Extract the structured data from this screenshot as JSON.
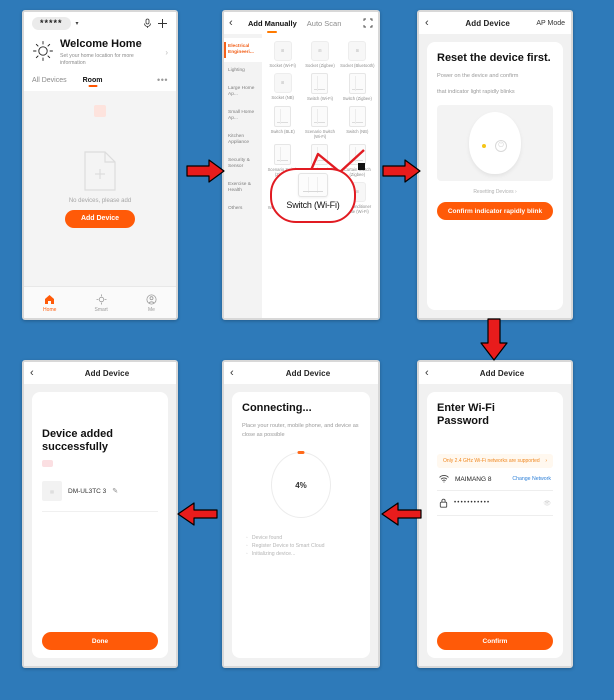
{
  "flow": {
    "background_color": "#2e7ab9",
    "accent_color": "#ff5a08",
    "arrow_color": "#e81c1c",
    "highlight_color": "#e11b22"
  },
  "screen1": {
    "home_name": "*****",
    "caret_icon": "chevron-down-icon",
    "mic_icon": "microphone-icon",
    "add_icon": "plus-icon",
    "weather_icon": "sun-icon",
    "title": "Welcome Home",
    "subtitle": "Set your home location for more information",
    "chevron": "›",
    "tabs": [
      {
        "label": "All Devices",
        "active": false
      },
      {
        "label": "Room",
        "active": true
      }
    ],
    "more_icon": "more-options-icon",
    "empty_text": "No devices, please add",
    "add_device_label": "Add Device",
    "tabbar": [
      {
        "label": "Home",
        "icon": "home-icon",
        "active": true
      },
      {
        "label": "Smart",
        "icon": "smart-icon",
        "active": false
      },
      {
        "label": "Me",
        "icon": "profile-icon",
        "active": false
      }
    ]
  },
  "screen2": {
    "back_icon": "back-chevron-icon",
    "tabs": [
      {
        "label": "Add Manually",
        "active": true
      },
      {
        "label": "Auto Scan",
        "active": false
      }
    ],
    "scan_icon": "qr-scan-icon",
    "categories": [
      {
        "label": "Electrical Engineeri...",
        "active": true
      },
      {
        "label": "Lighting",
        "active": false
      },
      {
        "label": "Large Home Ap...",
        "active": false
      },
      {
        "label": "Small Home Ap...",
        "active": false
      },
      {
        "label": "Kitchen Appliance",
        "active": false
      },
      {
        "label": "Security & Sensor",
        "active": false
      },
      {
        "label": "Exercise & Health",
        "active": false
      },
      {
        "label": "Others",
        "active": false
      }
    ],
    "devices": [
      {
        "label": "Socket (Wi-Fi)",
        "kind": "socket"
      },
      {
        "label": "Socket (Zigbee)",
        "kind": "socket"
      },
      {
        "label": "Socket (Bluetooth)",
        "kind": "socket"
      },
      {
        "label": "Socket (NB)",
        "kind": "socket"
      },
      {
        "label": "Switch (Wi-Fi)",
        "kind": "switch"
      },
      {
        "label": "Switch (Zigbee)",
        "kind": "switch"
      },
      {
        "label": "Switch (BLE)",
        "kind": "switch"
      },
      {
        "label": "Scenario Switch (Wi-Fi)",
        "kind": "switch"
      },
      {
        "label": "Switch (NB)",
        "kind": "switch"
      },
      {
        "label": "Scenario Switch (Zigbee)",
        "kind": "switch"
      },
      {
        "label": "Curtain Switch (Wi-Fi)",
        "kind": "switch"
      },
      {
        "label": "Curtain Switch (Zigbee)",
        "kind": "switch"
      },
      {
        "label": "Wireless Switch",
        "kind": "switch"
      },
      {
        "label": "Scenario Light Socket (Wi-Fi)",
        "kind": "light"
      },
      {
        "label": "Air Conditioner Mate (Wi-Fi)",
        "kind": "socket"
      }
    ],
    "callout_label": "Switch (Wi-Fi)"
  },
  "screen3": {
    "back_icon": "back-chevron-icon",
    "title": "Add Device",
    "right_label": "AP Mode",
    "heading": "Reset the device first.",
    "line1": "Power on the device and confirm",
    "line2": "that indicator light rapidly blinks",
    "reset_link": "Resetting Devices ›",
    "confirm_label": "Confirm indicator rapidly blink",
    "led_color": "#f5c518",
    "power_icon": "power-icon"
  },
  "screen4": {
    "back_icon": "back-chevron-icon",
    "title": "Add Device",
    "heading_line1": "Enter Wi-Fi",
    "heading_line2": "Password",
    "warning": "Only 2.4 GHz Wi-Fi networks are supported",
    "warning_chevron": "›",
    "wifi_icon": "wifi-icon",
    "ssid": "MAIMANG 8",
    "change_network": "Change Network",
    "lock_icon": "lock-icon",
    "password_value": "•••••••••••",
    "eye_icon": "eye-toggle-icon",
    "confirm_label": "Confirm"
  },
  "screen5": {
    "back_icon": "back-chevron-icon",
    "title": "Add Device",
    "heading": "Connecting...",
    "subtitle": "Place your router, mobile phone, and device as close as possible",
    "progress_percent": "4%",
    "steps": [
      "Device found",
      "Register Device to Smart Cloud",
      "Initializing device..."
    ]
  },
  "screen6": {
    "back_icon": "back-chevron-icon",
    "title": "Add Device",
    "heading_line1": "Device added",
    "heading_line2": "successfully",
    "device_name": "DM-UL3TC 3",
    "edit_icon": "pencil-edit-icon",
    "done_label": "Done"
  },
  "arrows": [
    {
      "name": "arrow-home-to-add-manually",
      "direction": "right"
    },
    {
      "name": "arrow-add-manually-to-reset",
      "direction": "right"
    },
    {
      "name": "arrow-reset-to-wifi",
      "direction": "down"
    },
    {
      "name": "arrow-wifi-to-connecting",
      "direction": "left"
    },
    {
      "name": "arrow-connecting-to-success",
      "direction": "left"
    }
  ]
}
